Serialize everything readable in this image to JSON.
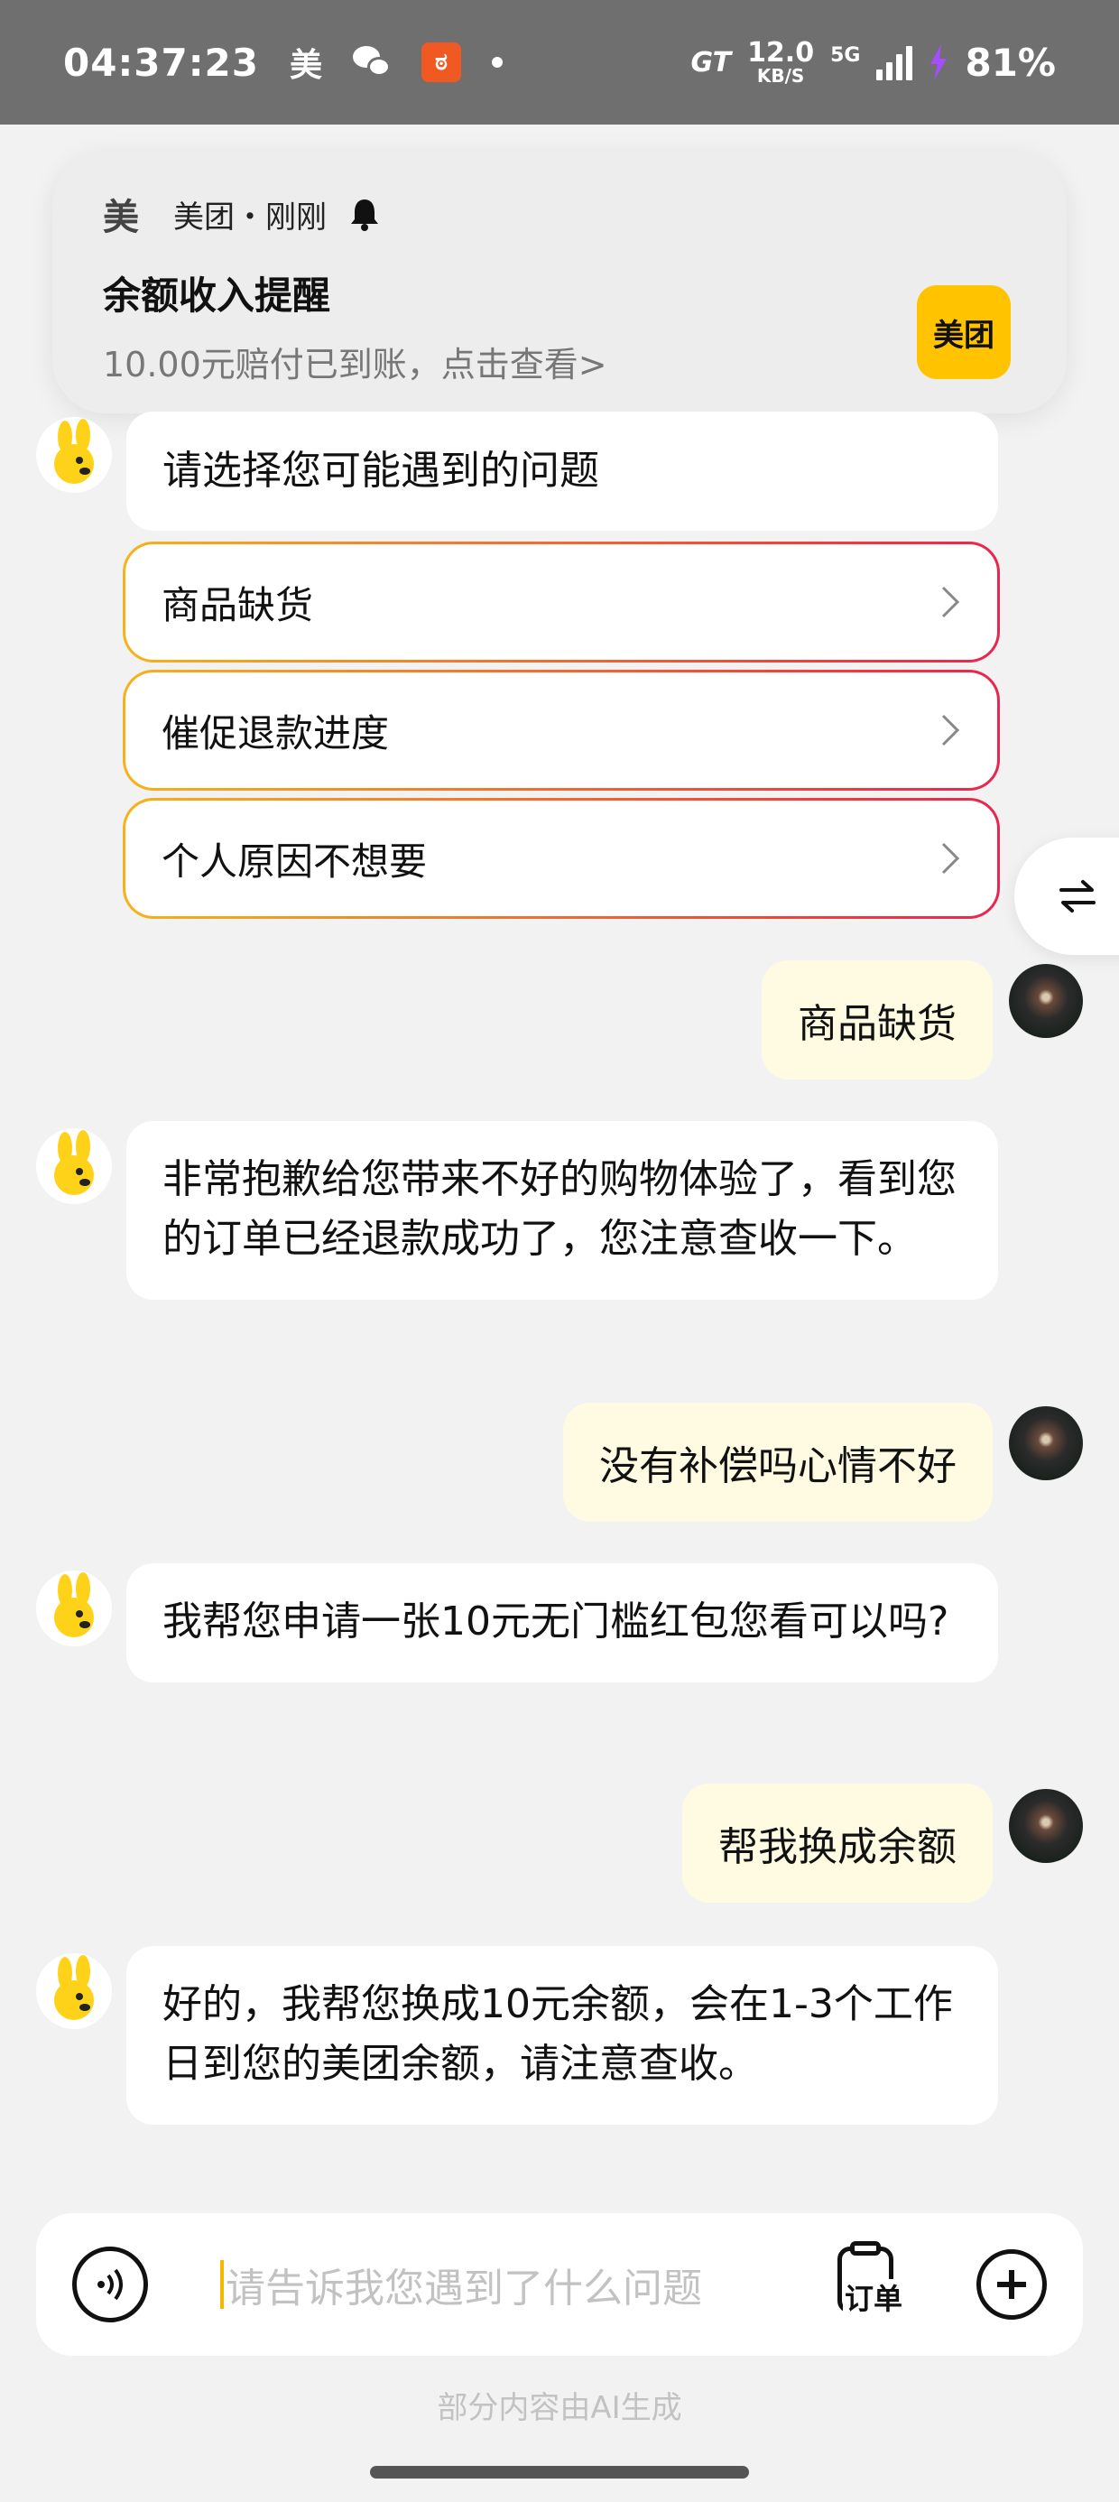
{
  "status_bar": {
    "time": "04:37:23",
    "app_mei": "美",
    "app_orange": "ಠ",
    "gt": "GT",
    "speed_value": "12.0",
    "speed_unit": "KB/S",
    "network": "5G",
    "battery": "81%"
  },
  "notification": {
    "app_icon": "美",
    "source": "美团・刚刚",
    "title": "余额收入提醒",
    "body": "10.00元赔付已到账，点击查看>",
    "logo_text": "美团"
  },
  "chat": {
    "prompt": "请选择您可能遇到的问题",
    "options": [
      "商品缺货",
      "催促退款进度",
      "个人原因不想要"
    ],
    "messages": [
      {
        "from": "user",
        "text": "商品缺货"
      },
      {
        "from": "bot",
        "text": "非常抱歉给您带来不好的购物体验了，看到您的订单已经退款成功了，您注意查收一下。"
      },
      {
        "from": "user",
        "text": "没有补偿吗心情不好"
      },
      {
        "from": "bot",
        "text": "我帮您申请一张10元无门槛红包您看可以吗?"
      },
      {
        "from": "user",
        "text": "帮我换成余额"
      },
      {
        "from": "bot",
        "text": "好的，我帮您换成10元余额，会在1-3个工作日到您的美团余额，请注意查收。"
      }
    ]
  },
  "input": {
    "placeholder": "请告诉我您遇到了什么问题",
    "order_label": "订单"
  },
  "footnote": "部分内容由AI生成",
  "colors": {
    "status_bar_bg": "#6f6f6f",
    "brand_yellow": "#ffc300",
    "user_bubble": "#fffbe3",
    "option_gradient_start": "#f7b21a",
    "option_gradient_end": "#e8264f"
  },
  "icons": [
    "wechat-icon",
    "bell-icon",
    "chevron-right-icon",
    "swap-icon",
    "voice-icon",
    "order-icon",
    "plus-icon",
    "bot-avatar",
    "user-avatar"
  ]
}
